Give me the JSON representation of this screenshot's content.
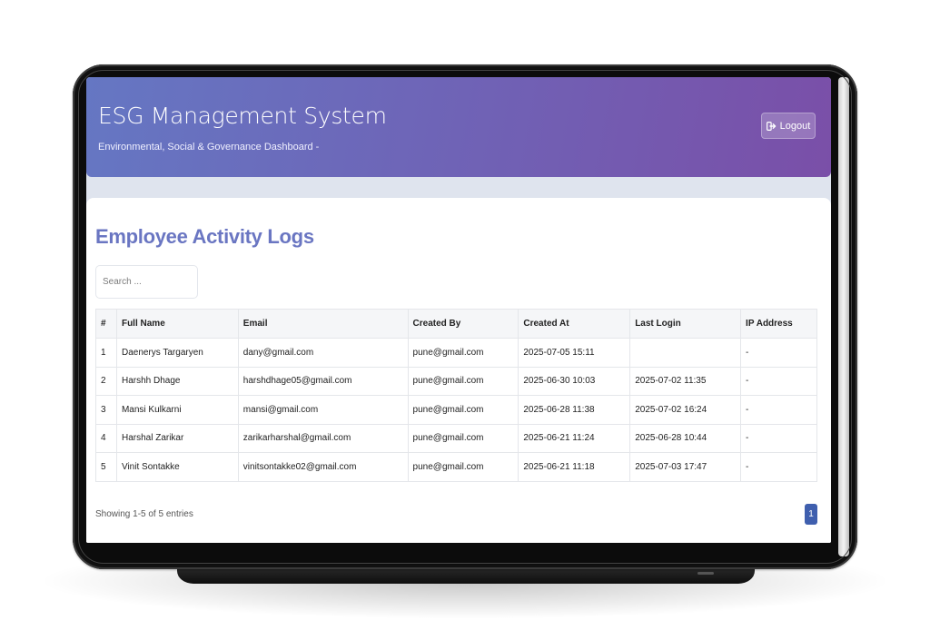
{
  "header": {
    "title": "ESG Management System",
    "subtitle": "Environmental, Social & Governance Dashboard -",
    "logout_label": "Logout"
  },
  "main": {
    "title": "Employee Activity Logs",
    "search": {
      "placeholder": "Search ...",
      "value": ""
    },
    "table": {
      "columns": [
        "#",
        "Full Name",
        "Email",
        "Created By",
        "Created At",
        "Last Login",
        "IP Address"
      ],
      "rows": [
        [
          "1",
          "Daenerys Targaryen",
          "dany@gmail.com",
          "pune@gmail.com",
          "2025-07-05 15:11",
          "",
          "-"
        ],
        [
          "2",
          "Harshh Dhage",
          "harshdhage05@gmail.com",
          "pune@gmail.com",
          "2025-06-30 10:03",
          "2025-07-02 11:35",
          "-"
        ],
        [
          "3",
          "Mansi Kulkarni",
          "mansi@gmail.com",
          "pune@gmail.com",
          "2025-06-28 11:38",
          "2025-07-02 16:24",
          "-"
        ],
        [
          "4",
          "Harshal Zarikar",
          "zarikarharshal@gmail.com",
          "pune@gmail.com",
          "2025-06-21 11:24",
          "2025-06-28 10:44",
          "-"
        ],
        [
          "5",
          "Vinit Sontakke",
          "vinitsontakke02@gmail.com",
          "pune@gmail.com",
          "2025-06-21 11:18",
          "2025-07-03 17:47",
          "-"
        ]
      ]
    },
    "footer": {
      "showing": "Showing 1-5 of 5 entries",
      "current_page": "1"
    }
  },
  "icons": {
    "logout": "logout-icon"
  },
  "colors": {
    "header_start": "#6577c3",
    "header_end": "#7a4fa8",
    "title": "#6a76c2",
    "page_active": "#3f5fae"
  }
}
